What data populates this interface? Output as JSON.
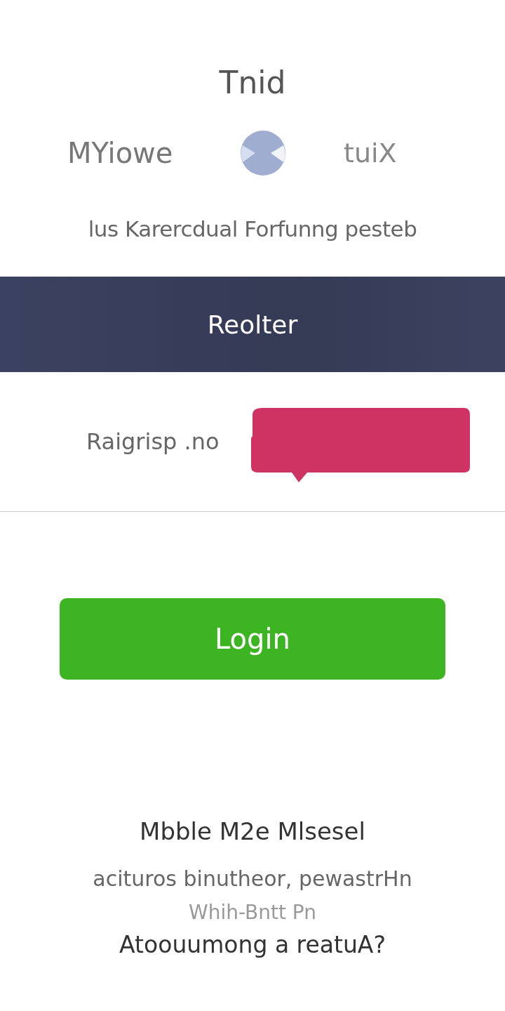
{
  "title": "Tnid",
  "toggle_row": {
    "left_label": "MYiowe",
    "right_label": "tuiX"
  },
  "subtitle": "lus Karercdual Forfunng pesteb",
  "header_bar": {
    "label": "Reolter"
  },
  "field_row": {
    "label": "Raigrisp .no"
  },
  "login_button": {
    "label": "Login"
  },
  "footer": {
    "heading": "Mbble M2e Mlsesel",
    "lines": [
      "acituros binutheor, pewastrHn",
      "Whih-Bntt Pn"
    ],
    "question": "Atoouumong a reatuA?"
  }
}
